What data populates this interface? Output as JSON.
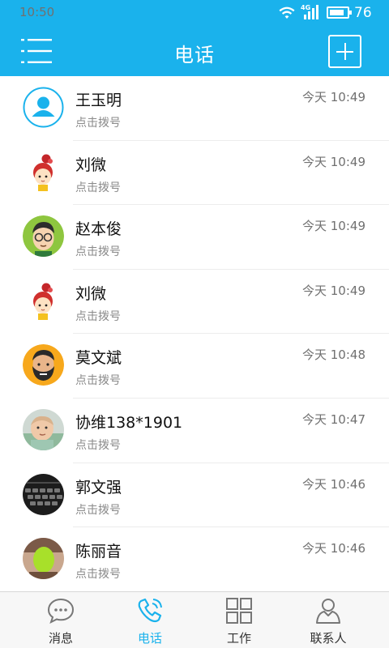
{
  "status_bar": {
    "time": "10:50",
    "network": "4G",
    "battery": "76",
    "icons": [
      "wifi-icon",
      "cell-signal-icon",
      "battery-icon"
    ]
  },
  "header": {
    "title": "电话",
    "menu_icon": "menu-list-icon",
    "add_icon": "plus-icon"
  },
  "calls": [
    {
      "name": "王玉明",
      "sub": "点击拨号",
      "time": "今天 10:49",
      "avatar": "default-person-icon"
    },
    {
      "name": "刘微",
      "sub": "点击拨号",
      "time": "今天 10:49",
      "avatar": "cartoon-girl-avatar"
    },
    {
      "name": "赵本俊",
      "sub": "点击拨号",
      "time": "今天 10:49",
      "avatar": "cartoon-man-glasses-avatar"
    },
    {
      "name": "刘微",
      "sub": "点击拨号",
      "time": "今天 10:49",
      "avatar": "cartoon-girl-avatar"
    },
    {
      "name": "莫文斌",
      "sub": "点击拨号",
      "time": "今天 10:48",
      "avatar": "cartoon-bearded-man-avatar"
    },
    {
      "name": "协维138*1901",
      "sub": "点击拨号",
      "time": "今天 10:47",
      "avatar": "baby-photo-avatar"
    },
    {
      "name": "郭文强",
      "sub": "点击拨号",
      "time": "今天 10:46",
      "avatar": "keyboard-photo-avatar"
    },
    {
      "name": "陈丽音",
      "sub": "点击拨号",
      "time": "今天 10:46",
      "avatar": "obscured-photo-avatar"
    }
  ],
  "tabs": [
    {
      "label": "消息",
      "icon": "chat-bubble-icon",
      "active": false
    },
    {
      "label": "电话",
      "icon": "phone-icon",
      "active": true
    },
    {
      "label": "工作",
      "icon": "grid-icon",
      "active": false
    },
    {
      "label": "联系人",
      "icon": "contact-person-icon",
      "active": false
    }
  ],
  "colors": {
    "accent": "#1ab2ec",
    "text": "#111111",
    "subtext": "#8a8a8a",
    "tab_bg": "#f7f7f7"
  }
}
